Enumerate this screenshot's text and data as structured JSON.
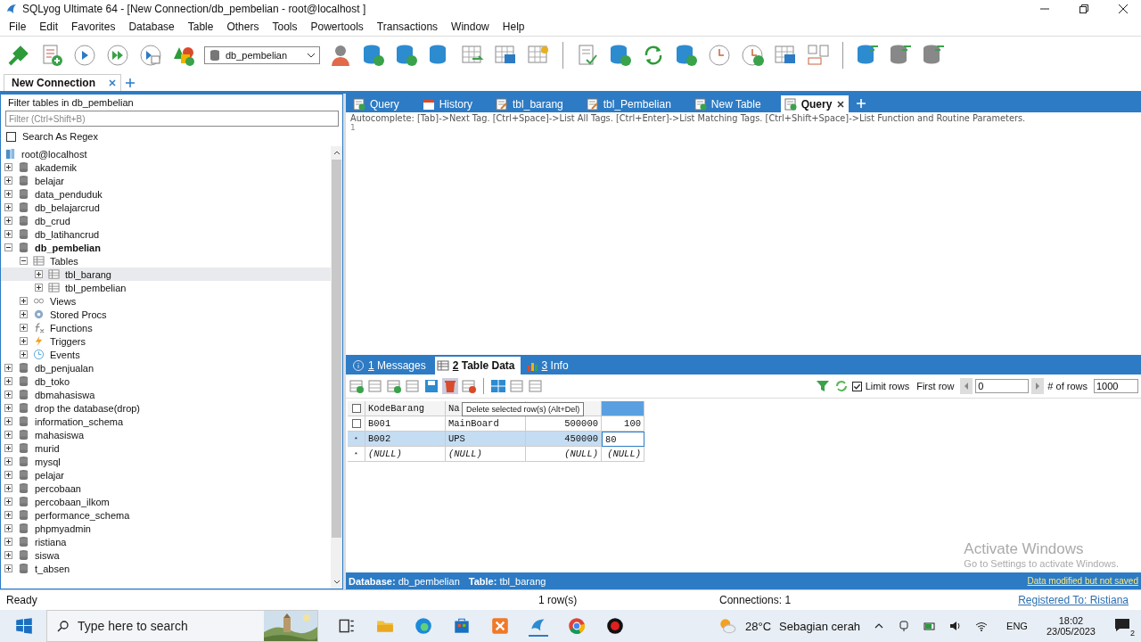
{
  "window": {
    "title": "SQLyog Ultimate 64 - [New Connection/db_pembelian - root@localhost ]"
  },
  "menu": [
    "File",
    "Edit",
    "Favorites",
    "Database",
    "Table",
    "Others",
    "Tools",
    "Powertools",
    "Transactions",
    "Window",
    "Help"
  ],
  "toolbar": {
    "database_select": "db_pembelian"
  },
  "connection_tabs": [
    {
      "label": "New Connection",
      "selected": true
    }
  ],
  "sidebar": {
    "filter_title": "Filter tables in db_pembelian",
    "filter": {
      "placeholder": "Filter (Ctrl+Shift+B)"
    },
    "regex": {
      "label": "Search As Regex",
      "checked": false
    },
    "tree": [
      {
        "kind": "server",
        "label": "root@localhost",
        "children": [
          {
            "kind": "database",
            "label": "akademik",
            "expanded": false,
            "current": false
          },
          {
            "kind": "database",
            "label": "belajar",
            "expanded": false,
            "current": false
          },
          {
            "kind": "database",
            "label": "data_penduduk",
            "expanded": false,
            "current": false
          },
          {
            "kind": "database",
            "label": "db_belajarcrud",
            "expanded": false,
            "current": false
          },
          {
            "kind": "database",
            "label": "db_crud",
            "expanded": false,
            "current": false
          },
          {
            "kind": "database",
            "label": "db_latihancrud",
            "expanded": false,
            "current": false
          },
          {
            "kind": "database",
            "label": "db_pembelian",
            "expanded": true,
            "current": true,
            "children": [
              {
                "kind": "tables",
                "label": "Tables",
                "expanded": true,
                "children": [
                  {
                    "kind": "table",
                    "label": "tbl_barang",
                    "expanded": false,
                    "selected": true
                  },
                  {
                    "kind": "table",
                    "label": "tbl_pembelian",
                    "expanded": false,
                    "selected": false
                  }
                ]
              },
              {
                "kind": "views",
                "label": "Views",
                "expanded": false
              },
              {
                "kind": "procs",
                "label": "Stored Procs",
                "expanded": false
              },
              {
                "kind": "functions",
                "label": "Functions",
                "expanded": false
              },
              {
                "kind": "triggers",
                "label": "Triggers",
                "expanded": false
              },
              {
                "kind": "events",
                "label": "Events",
                "expanded": false
              }
            ]
          },
          {
            "kind": "database",
            "label": "db_penjualan",
            "expanded": false,
            "current": false
          },
          {
            "kind": "database",
            "label": "db_toko",
            "expanded": false,
            "current": false
          },
          {
            "kind": "database",
            "label": "dbmahasiswa",
            "expanded": false,
            "current": false
          },
          {
            "kind": "database",
            "label": "drop the database(drop)",
            "expanded": false,
            "current": false
          },
          {
            "kind": "database",
            "label": "information_schema",
            "expanded": false,
            "current": false
          },
          {
            "kind": "database",
            "label": "mahasiswa",
            "expanded": false,
            "current": false
          },
          {
            "kind": "database",
            "label": "murid",
            "expanded": false,
            "current": false
          },
          {
            "kind": "database",
            "label": "mysql",
            "expanded": false,
            "current": false
          },
          {
            "kind": "database",
            "label": "pelajar",
            "expanded": false,
            "current": false
          },
          {
            "kind": "database",
            "label": "percobaan",
            "expanded": false,
            "current": false
          },
          {
            "kind": "database",
            "label": "percobaan_ilkom",
            "expanded": false,
            "current": false
          },
          {
            "kind": "database",
            "label": "performance_schema",
            "expanded": false,
            "current": false
          },
          {
            "kind": "database",
            "label": "phpmyadmin",
            "expanded": false,
            "current": false
          },
          {
            "kind": "database",
            "label": "ristiana",
            "expanded": false,
            "current": false
          },
          {
            "kind": "database",
            "label": "siswa",
            "expanded": false,
            "current": false
          },
          {
            "kind": "database",
            "label": "t_absen",
            "expanded": false,
            "current": false
          }
        ]
      }
    ]
  },
  "query_tabs": [
    {
      "kind": "query",
      "label": "Query",
      "selected": false
    },
    {
      "kind": "history",
      "label": "History",
      "selected": false
    },
    {
      "kind": "table",
      "label": "tbl_barang",
      "selected": false
    },
    {
      "kind": "table",
      "label": "tbl_Pembelian",
      "selected": false
    },
    {
      "kind": "new_table",
      "label": "New Table",
      "selected": false
    },
    {
      "kind": "query",
      "label": "Query",
      "selected": true
    }
  ],
  "editor": {
    "hint": "Autocomplete: [Tab]->Next Tag. [Ctrl+Space]->List All Tags. [Ctrl+Enter]->List Matching Tags. [Ctrl+Shift+Space]->List Function and Routine Parameters.",
    "line_number": "1"
  },
  "result_tabs": [
    {
      "kind": "messages",
      "number": "1",
      "label": "Messages",
      "selected": false
    },
    {
      "kind": "table",
      "number": "2",
      "label": "Table Data",
      "selected": true
    },
    {
      "kind": "info",
      "number": "3",
      "label": "Info",
      "selected": false
    }
  ],
  "limit": {
    "label": "Limit rows",
    "checked": true,
    "first_row_label": "First row",
    "first_row": "0",
    "rows_label": "# of rows",
    "rows": "1000"
  },
  "table": {
    "columns": [
      {
        "label": "KodeBarang",
        "numeric": false,
        "selected": false
      },
      {
        "label": "Na",
        "numeric": false,
        "selected": false
      },
      {
        "numeric": true,
        "selected": false
      },
      {
        "numeric": true,
        "selected": true
      }
    ],
    "rows": [
      {
        "kind": "saved",
        "selected": false,
        "cells": [
          {
            "text": "B001",
            "editing": false
          },
          {
            "text": "MainBoard",
            "editing": false
          },
          {
            "text": "500000",
            "editing": false
          },
          {
            "text": "100",
            "editing": false
          }
        ]
      },
      {
        "kind": "edited",
        "marker": "*",
        "selected": true,
        "cells": [
          {
            "text": "B002",
            "editing": false
          },
          {
            "text": "UPS",
            "editing": false
          },
          {
            "text": "450000",
            "editing": false
          },
          {
            "text": "80",
            "editing": true
          }
        ]
      },
      {
        "kind": "new",
        "marker": "*",
        "selected": false,
        "cells": [
          {
            "text": "(NULL)",
            "editing": false
          },
          {
            "text": "(NULL)",
            "editing": false
          },
          {
            "text": "(NULL)",
            "editing": false
          },
          {
            "text": "(NULL)",
            "editing": false
          }
        ]
      }
    ],
    "tooltip": "Delete selected row(s) (Alt+Del)"
  },
  "activation": {
    "title": "Activate Windows",
    "subtitle": "Go to Settings to activate Windows."
  },
  "info_bar": {
    "database_label": "Database:",
    "database": "db_pembelian",
    "table_label": "Table:",
    "table": "tbl_barang",
    "notice": "Data modified but not saved"
  },
  "status_bar": {
    "state": "Ready",
    "rows": "1 row(s)",
    "connections": "Connections: 1",
    "registered": "Registered To: Ristiana"
  },
  "taskbar": {
    "search": {
      "placeholder": "Type here to search"
    },
    "weather": {
      "temperature": "28°C",
      "condition": "Sebagian cerah"
    },
    "language": "ENG",
    "time": "18:02",
    "date": "23/05/2023",
    "notifications": "2"
  }
}
